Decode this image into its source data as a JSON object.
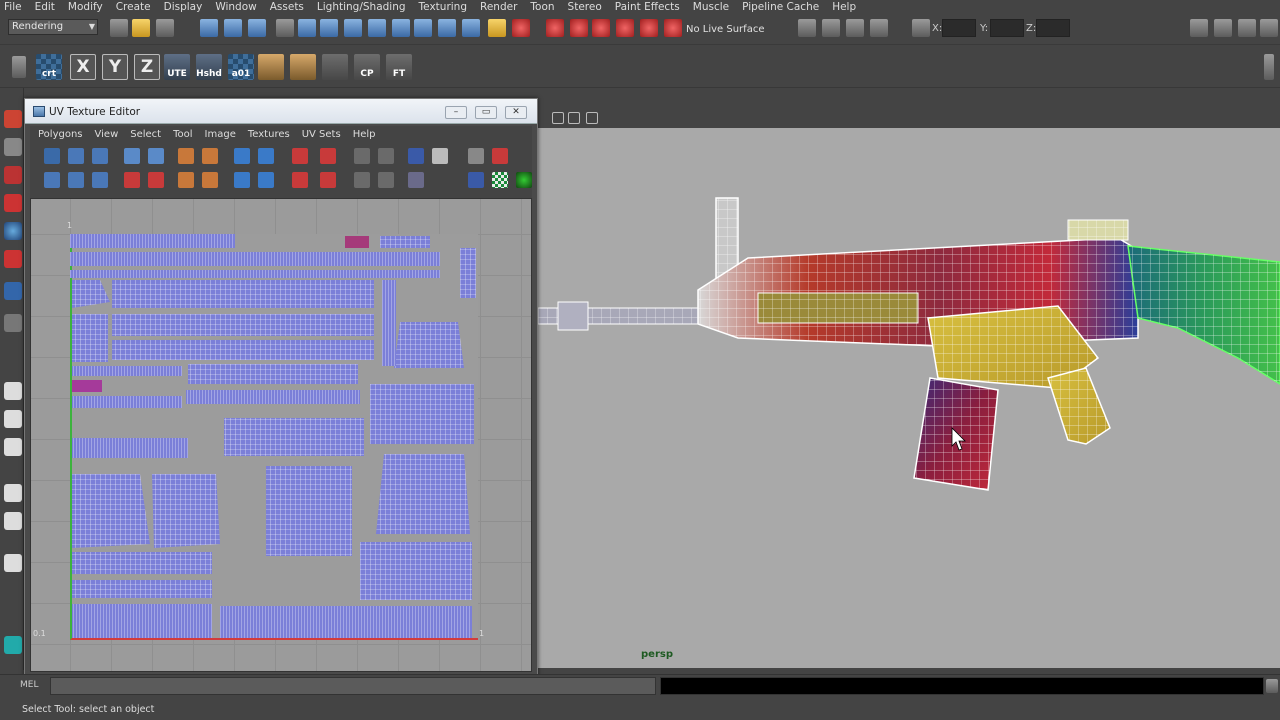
{
  "main_menu": [
    "File",
    "Edit",
    "Modify",
    "Create",
    "Display",
    "Window",
    "Assets",
    "Lighting/Shading",
    "Texturing",
    "Render",
    "Toon",
    "Stereo",
    "Paint Effects",
    "Muscle",
    "Pipeline Cache",
    "Help"
  ],
  "status_line": {
    "mode": "Rendering",
    "live_surface": "No Live Surface",
    "coord_labels": {
      "x": "X:",
      "y": "Y:",
      "z": "Z:"
    }
  },
  "shelf": {
    "buttons": [
      {
        "label": "crt",
        "icon": "create-checker-icon"
      },
      {
        "label": "X",
        "icon": "x-axis-icon"
      },
      {
        "label": "Y",
        "icon": "y-axis-icon"
      },
      {
        "label": "Z",
        "icon": "z-axis-icon"
      },
      {
        "label": "UTE",
        "icon": "uv-texture-editor-icon"
      },
      {
        "label": "Hshd",
        "icon": "hypershade-icon"
      },
      {
        "label": "a01",
        "icon": "assign-shader-icon"
      },
      {
        "label": "",
        "icon": "planar-map-icon"
      },
      {
        "label": "",
        "icon": "texture-sphere-icon"
      },
      {
        "label": "",
        "icon": "axis-tool-icon"
      },
      {
        "label": "CP",
        "icon": "center-pivot-icon"
      },
      {
        "label": "FT",
        "icon": "freeze-transform-icon"
      }
    ]
  },
  "uv_editor": {
    "title": "UV Texture Editor",
    "window_controls": {
      "minimize": "–",
      "maximize": "▭",
      "close": "✕"
    },
    "menu": [
      "Polygons",
      "View",
      "Select",
      "Tool",
      "Image",
      "Textures",
      "UV Sets",
      "Help"
    ],
    "grid_labels": {
      "top_left": "1",
      "bottom_left": "0.1",
      "bottom_right": "1"
    }
  },
  "viewport": {
    "camera_label": "persp"
  },
  "command_line": {
    "label": "MEL"
  },
  "help_line": {
    "text": "Select Tool: select an object"
  },
  "colors": {
    "uv_shell_fill": "#7b7fd8",
    "uv_wire": "#ffffff",
    "viewport_bg": "#a9a9a9",
    "persp_label": "#1e5a22"
  }
}
